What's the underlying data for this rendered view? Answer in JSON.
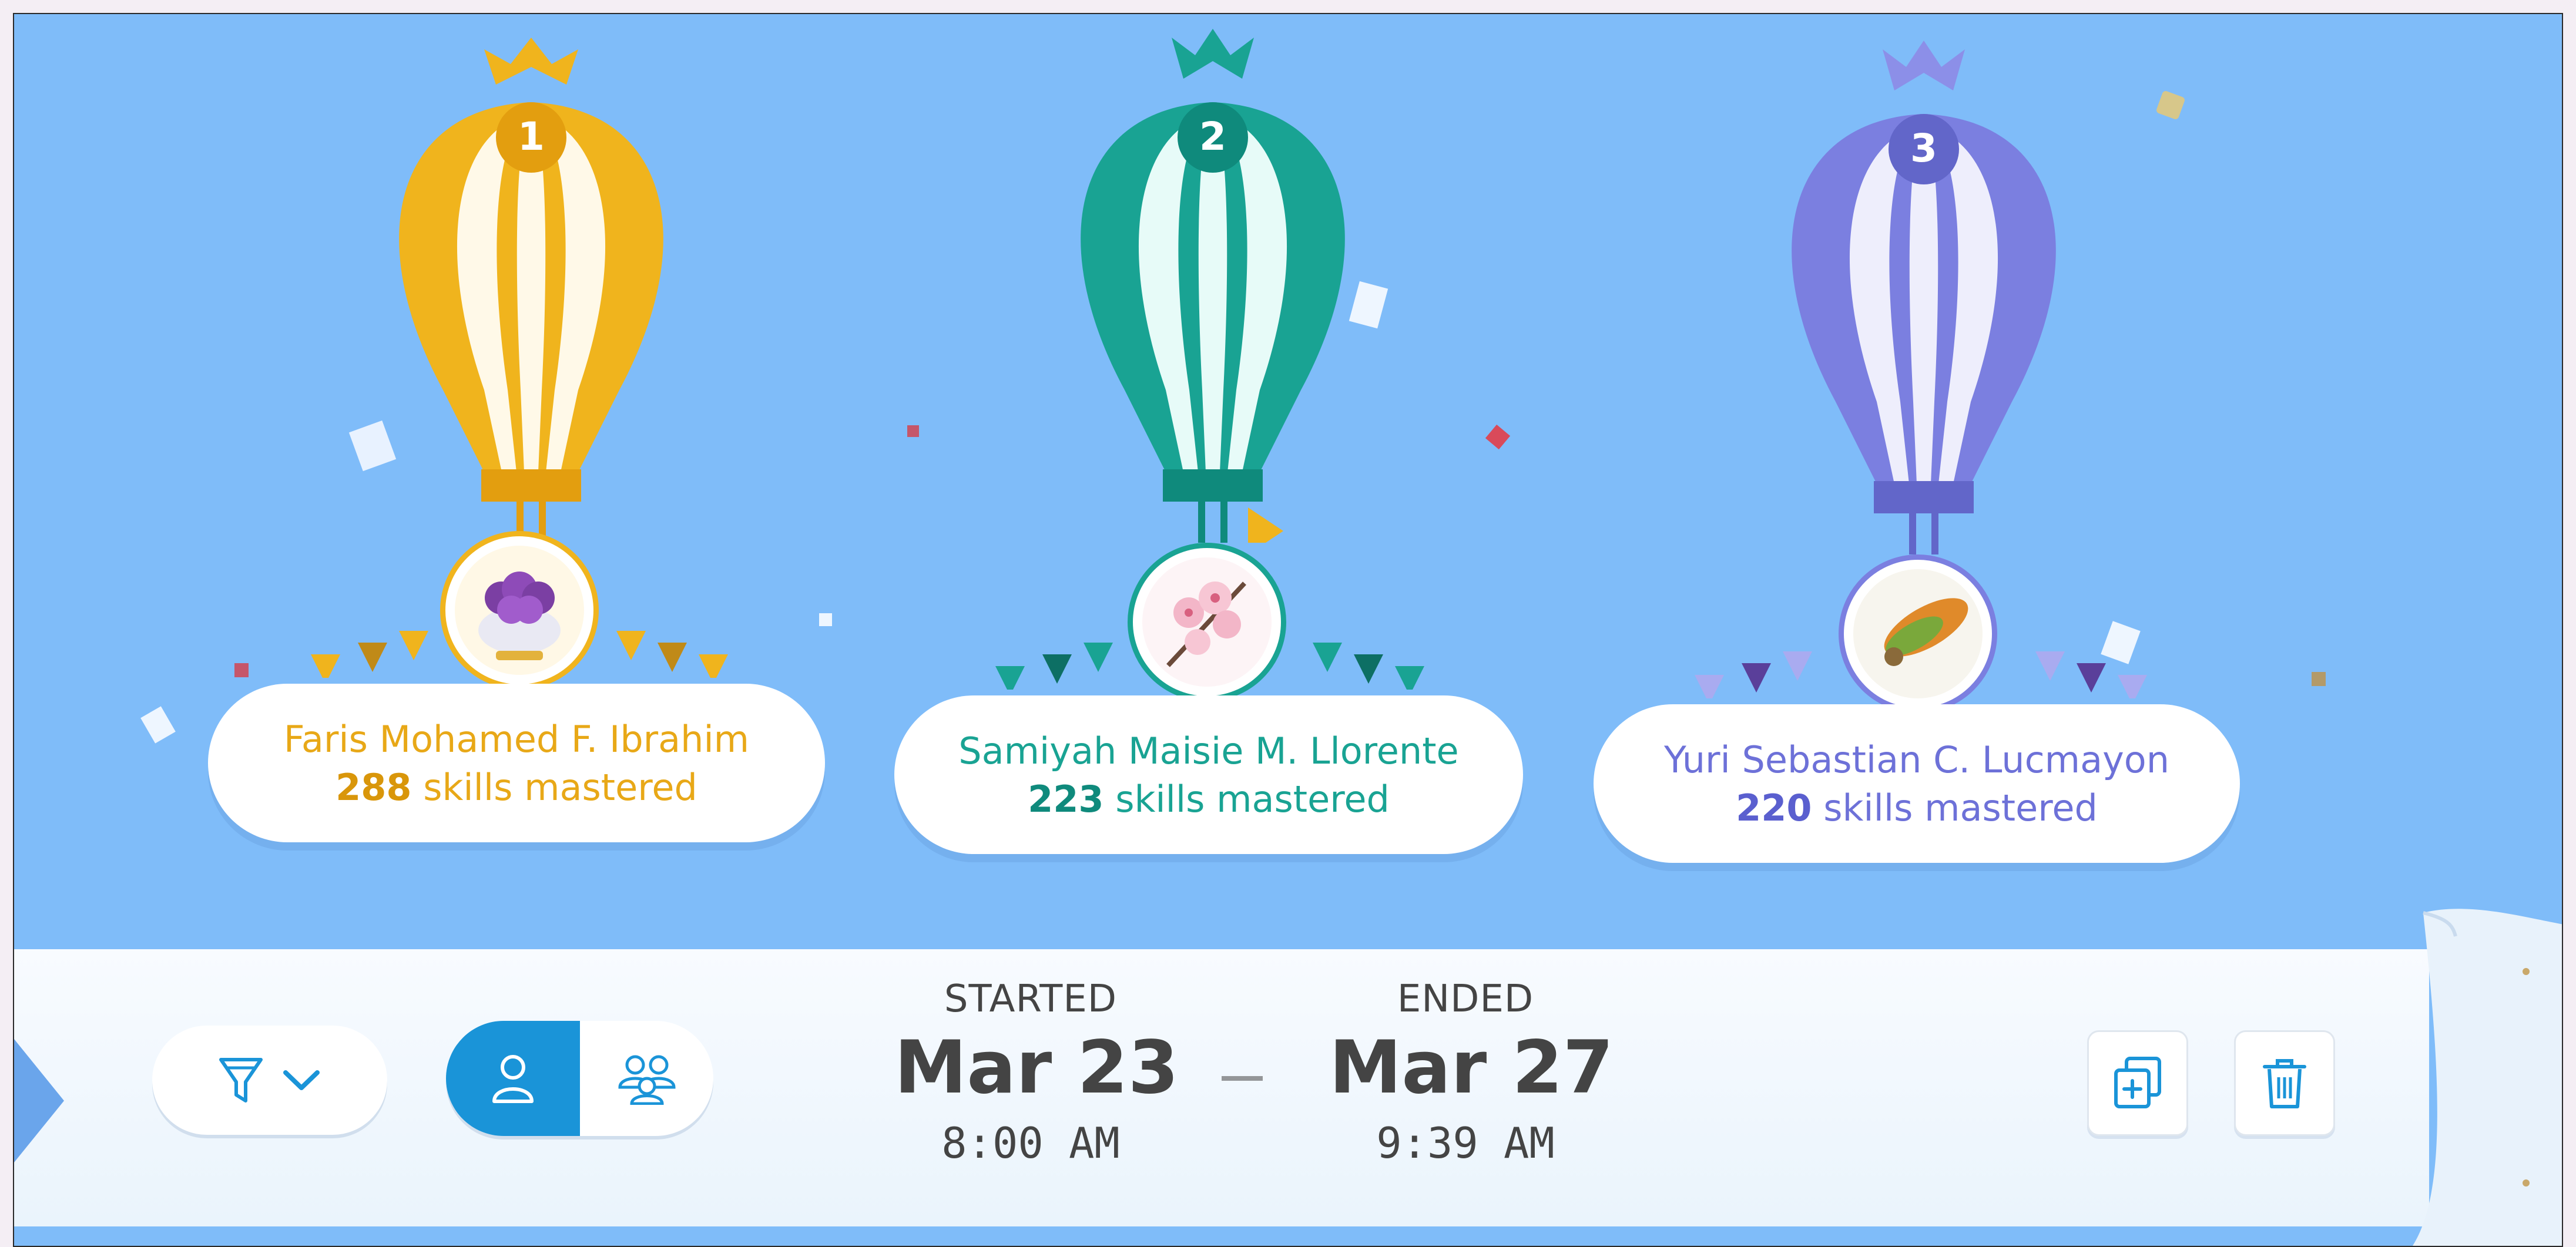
{
  "leaderboard": [
    {
      "rank": "1",
      "name": "Faris Mohamed F. Ibrahim",
      "skills_count": "288",
      "skills_suffix": " skills mastered",
      "color": "#f0b41d",
      "dark": "#e39e0f"
    },
    {
      "rank": "2",
      "name": "Samiyah Maisie M. Llorente",
      "skills_count": "223",
      "skills_suffix": " skills mastered",
      "color": "#19a393",
      "dark": "#0f8a7c"
    },
    {
      "rank": "3",
      "name": "Yuri Sebastian C. Lucmayon",
      "skills_count": "220",
      "skills_suffix": " skills mastered",
      "color": "#7b7fe0",
      "dark": "#6266c9"
    }
  ],
  "period": {
    "start_label": "STARTED",
    "start_date": "Mar 23",
    "start_time": "8:00 AM",
    "end_label": "ENDED",
    "end_date": "Mar 27",
    "end_time": "9:39 AM"
  },
  "controls": {
    "filter_icon": "funnel-icon",
    "dropdown_icon": "chevron-down-icon",
    "individual_icon": "single-user-icon",
    "group_icon": "group-users-icon",
    "duplicate_icon": "duplicate-icon",
    "delete_icon": "trash-icon",
    "accent_color": "#1a94d8"
  },
  "background_color": "#7fbcf9"
}
